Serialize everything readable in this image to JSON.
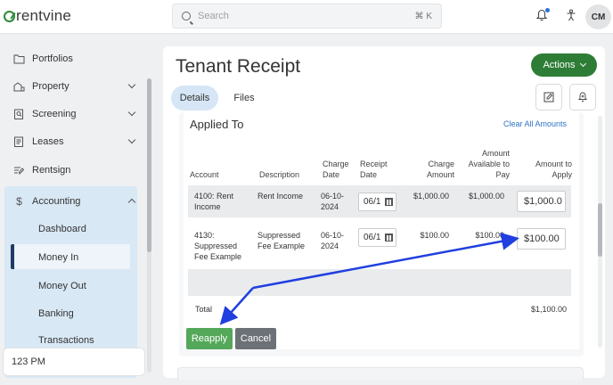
{
  "app": {
    "logo": "rentvine"
  },
  "search": {
    "placeholder": "Search",
    "shortcut": "⌘ K"
  },
  "user": {
    "initials": "CM"
  },
  "sidebar": {
    "items": [
      {
        "label": "Portfolios"
      },
      {
        "label": "Property"
      },
      {
        "label": "Screening"
      },
      {
        "label": "Leases"
      },
      {
        "label": "Rentsign"
      },
      {
        "label": "Accounting"
      }
    ],
    "accounting_sub": [
      {
        "label": "Dashboard"
      },
      {
        "label": "Money In"
      },
      {
        "label": "Money Out"
      },
      {
        "label": "Banking"
      },
      {
        "label": "Transactions"
      }
    ],
    "bottom_label": "123 PM"
  },
  "page": {
    "title": "Tenant Receipt",
    "actions_label": "Actions",
    "tabs": [
      {
        "label": "Details"
      },
      {
        "label": "Files"
      }
    ]
  },
  "applied_to": {
    "title": "Applied To",
    "clear_label": "Clear All Amounts",
    "headers": {
      "account": "Account",
      "description": "Description",
      "charge_date": "Charge\nDate",
      "receipt_date": "Receipt\nDate",
      "charge_amount": "Charge\nAmount",
      "available": "Amount\nAvailable to\nPay",
      "apply": "Amount to\nApply"
    },
    "rows": [
      {
        "account": "4100: Rent\nIncome",
        "description": "Rent Income",
        "charge_date": "06-10-\n2024",
        "receipt_date": "06/1",
        "charge_amount": "$1,000.00",
        "available": "$1,000.00",
        "apply": "$1,000.0"
      },
      {
        "account": "4130:\nSuppressed\nFee Example",
        "description": "Suppressed\nFee Example",
        "charge_date": "06-10-\n2024",
        "receipt_date": "06/1",
        "charge_amount": "$100.00",
        "available": "$100.00",
        "apply": "$100.00"
      }
    ],
    "total_label": "Total",
    "total_value": "$1,100.00",
    "reapply_label": "Reapply",
    "cancel_label": "Cancel"
  },
  "colors": {
    "accent_green": "#2e7d37",
    "annotation_blue": "#1f3fe0",
    "link_blue": "#2f73c8"
  }
}
